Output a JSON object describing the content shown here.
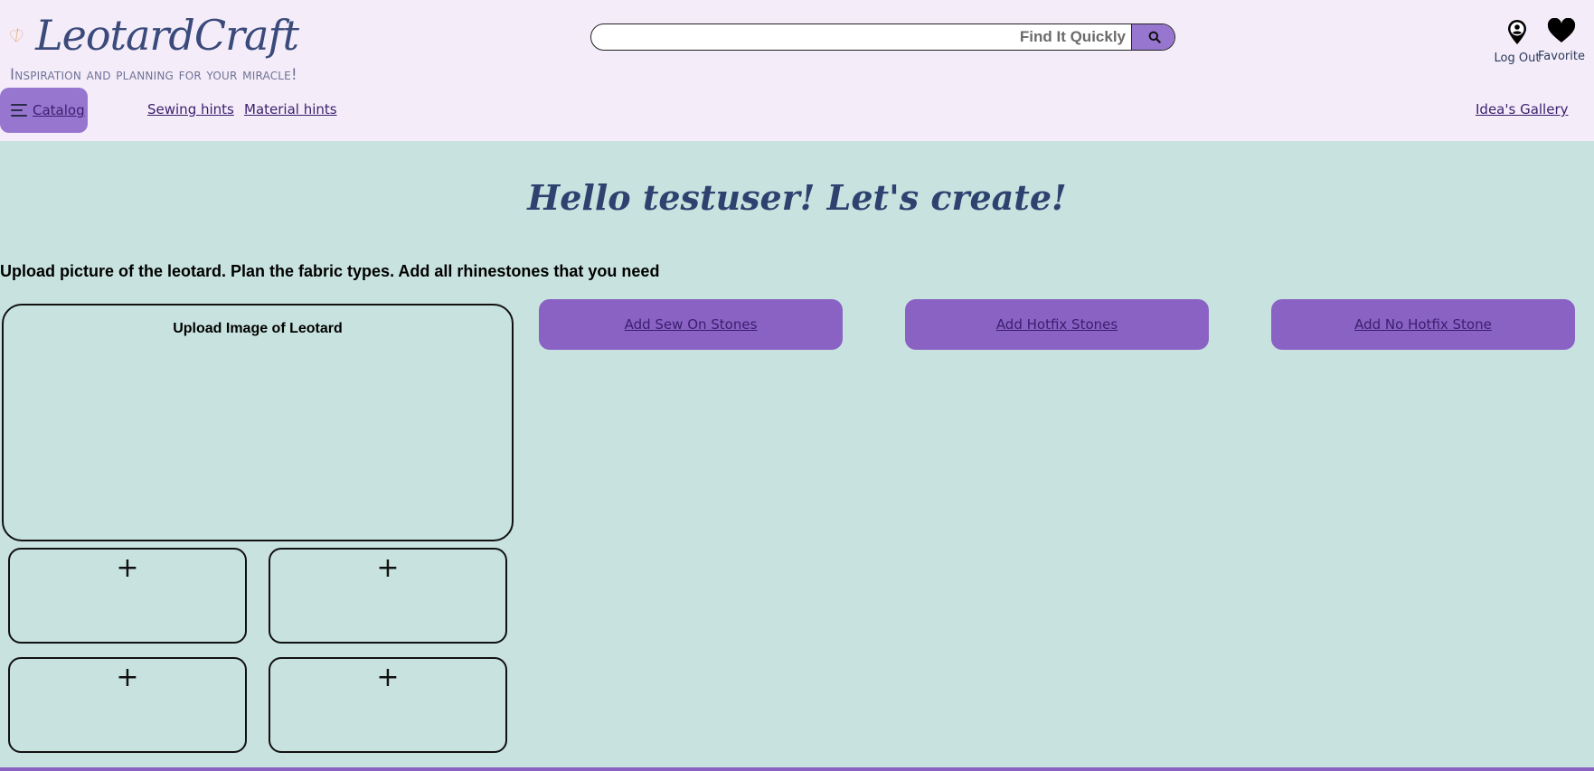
{
  "brand": {
    "name": "LeotardCraft",
    "tagline": "Inspiration and planning for your miracle!",
    "logo_icon": "heart-needle-icon",
    "accent_color": "#9776cf",
    "logo_color": "#e8944a"
  },
  "search": {
    "placeholder": "Find It Quickly",
    "value": "",
    "button_icon": "search-icon"
  },
  "user_menu": {
    "logout_label": "Log Out",
    "logout_icon": "user-pin-icon",
    "favorite_label": "Favorite",
    "favorite_icon": "heart-icon"
  },
  "nav": {
    "catalog_label": "Catalog",
    "catalog_icon": "menu-icon",
    "sewing_label": "Sewing hints",
    "material_label": "Material hints",
    "gallery_label": "Idea's Gallery"
  },
  "main": {
    "greeting": "Hello testuser! Let's create!",
    "intro": "Upload picture of the leotard. Plan the fabric types. Add all rhinestones that you need",
    "upload_title": "Upload Image of Leotard",
    "thumb_plus": "+",
    "stone_buttons": {
      "sew_on": "Add Sew On Stones",
      "hotfix": "Add Hotfix Stones",
      "no_hotfix": "Add No Hotfix Stone"
    }
  }
}
